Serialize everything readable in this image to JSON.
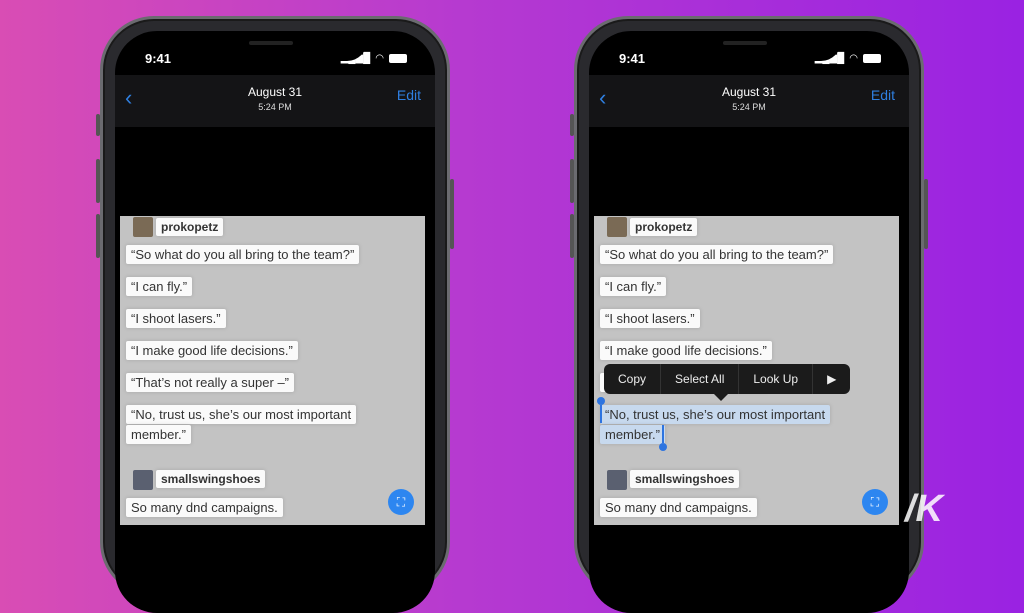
{
  "status": {
    "time": "9:41"
  },
  "nav": {
    "back": "‹",
    "title": "August 31",
    "subtitle": "5:24 PM",
    "edit": "Edit"
  },
  "messages": {
    "user1": "prokopetz",
    "lines": [
      "“So what do you all bring to the team?”",
      "“I can fly.”",
      "“I shoot lasers.”",
      "“I make good life decisions.”",
      "“That’s not really a super –”",
      "“No, trust us, she’s our most important",
      "member.”"
    ],
    "user2": "smallswingshoes",
    "reply": "So many dnd campaigns."
  },
  "context_menu": {
    "items": [
      "Copy",
      "Select All",
      "Look Up",
      "▶"
    ]
  },
  "watermark": "K",
  "colors": {
    "accent": "#2f7fe0",
    "selection": "#c7d9ee"
  }
}
